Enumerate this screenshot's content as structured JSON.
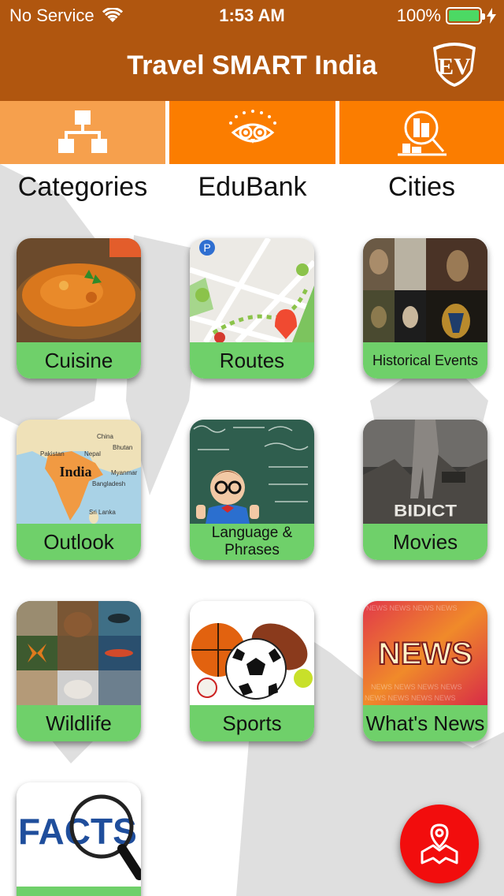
{
  "status_bar": {
    "carrier": "No Service",
    "time": "1:53 AM",
    "battery_percent": "100%"
  },
  "header": {
    "title": "Travel SMART India",
    "logo_text": "EV"
  },
  "top_nav": [
    {
      "label": "Categories",
      "icon": "hierarchy-icon"
    },
    {
      "label": "EduBank",
      "icon": "owl-icon"
    },
    {
      "label": "Cities",
      "icon": "city-search-icon"
    }
  ],
  "grid": [
    {
      "label": "Cuisine",
      "image": "curry-bowl"
    },
    {
      "label": "Routes",
      "image": "map-pins"
    },
    {
      "label": "Historical Events",
      "image": "historical-figures"
    },
    {
      "label": "Outlook",
      "image": "india-map"
    },
    {
      "label": "Language & Phrases",
      "image": "chalkboard-kid"
    },
    {
      "label": "Movies",
      "image": "movie-poster"
    },
    {
      "label": "Wildlife",
      "image": "animal-collage"
    },
    {
      "label": "Sports",
      "image": "sports-balls"
    },
    {
      "label": "What's News",
      "image": "news-banner"
    },
    {
      "label": "",
      "image": "facts-magnifier"
    }
  ],
  "facts_image_text": "FACTS",
  "news_image_text": "NEWS",
  "map_labels": {
    "country": "India",
    "neighbors": [
      "China",
      "Pakistan",
      "Nepal",
      "Bhutan",
      "Myanmar",
      "Bangladesh",
      "Sri Lanka"
    ]
  },
  "colors": {
    "header": "#b0560f",
    "nav_light": "#f6a04d",
    "nav_dark": "#fb7d00",
    "card_label": "#6fd06a",
    "fab": "#f20d0d"
  }
}
